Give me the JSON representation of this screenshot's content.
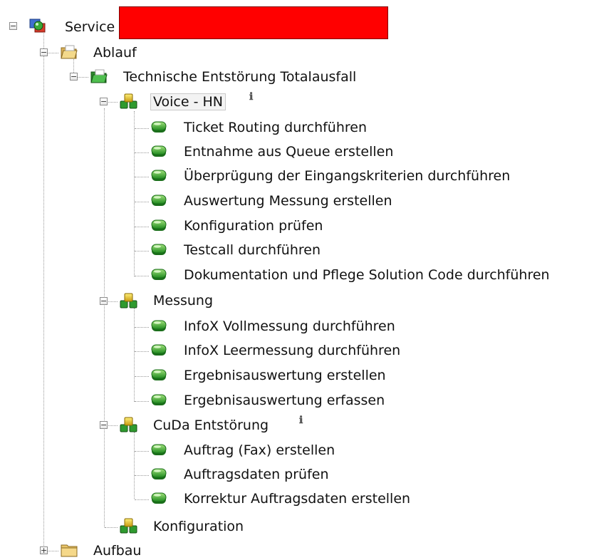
{
  "tree": {
    "root": {
      "label": "Service",
      "expander": "−",
      "icon": "service-globe-icon"
    },
    "ablauf": {
      "label": "Ablauf",
      "expander": "−",
      "icon": "open-folder-icon"
    },
    "technische": {
      "label": "Technische Entstörung Totalausfall",
      "expander": "−",
      "icon": "green-folder-icon"
    },
    "voice": {
      "label": "Voice - HN",
      "expander": "−",
      "icon": "yellow-cubes-icon",
      "info": "ℹ",
      "tasks": [
        "Ticket Routing durchführen",
        "Entnahme aus Queue erstellen",
        "Überprügung der Eingangskriterien durchführen",
        "Auswertung Messung erstellen",
        "Konfiguration prüfen",
        "Testcall durchführen",
        "Dokumentation und Pflege Solution Code durchführen"
      ]
    },
    "messung": {
      "label": "Messung",
      "expander": "−",
      "icon": "yellow-cubes-icon",
      "tasks": [
        "InfoX Vollmessung durchführen",
        "InfoX Leermessung durchführen",
        "Ergebnisauswertung erstellen",
        "Ergebnisauswertung erfassen"
      ]
    },
    "cuda": {
      "label": "CuDa Entstörung",
      "expander": "−",
      "icon": "yellow-cubes-icon",
      "info": "ℹ",
      "tasks": [
        "Auftrag (Fax) erstellen",
        "Auftragsdaten prüfen",
        "Korrektur Auftragsdaten erstellen"
      ]
    },
    "konfiguration": {
      "label": "Konfiguration",
      "icon": "yellow-cubes-icon"
    },
    "aufbau": {
      "label": "Aufbau",
      "expander": "+",
      "icon": "closed-folder-icon"
    }
  },
  "colors": {
    "redaction": "#ff0000",
    "task_green": "#3db33d",
    "cube_yellow": "#e8c21a"
  }
}
